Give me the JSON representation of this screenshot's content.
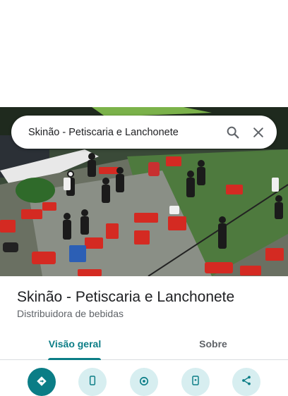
{
  "search": {
    "query": "Skinão - Petiscaria e Lanchonete"
  },
  "place": {
    "name": "Skinão - Petiscaria e Lanchonete",
    "category": "Distribuidora de bebidas"
  },
  "tabs": [
    {
      "label": "Visão geral",
      "active": true
    },
    {
      "label": "Sobre",
      "active": false
    }
  ],
  "actions": [
    {
      "icon": "directions-icon",
      "primary": true
    },
    {
      "icon": "phone-icon",
      "primary": false
    },
    {
      "icon": "location-icon",
      "primary": false
    },
    {
      "icon": "send-to-phone-icon",
      "primary": false
    },
    {
      "icon": "share-icon",
      "primary": false
    }
  ],
  "colors": {
    "accent": "#0b7d86",
    "accent_light": "#d7eef0",
    "title": "#202124",
    "subtitle": "#5f6368"
  }
}
